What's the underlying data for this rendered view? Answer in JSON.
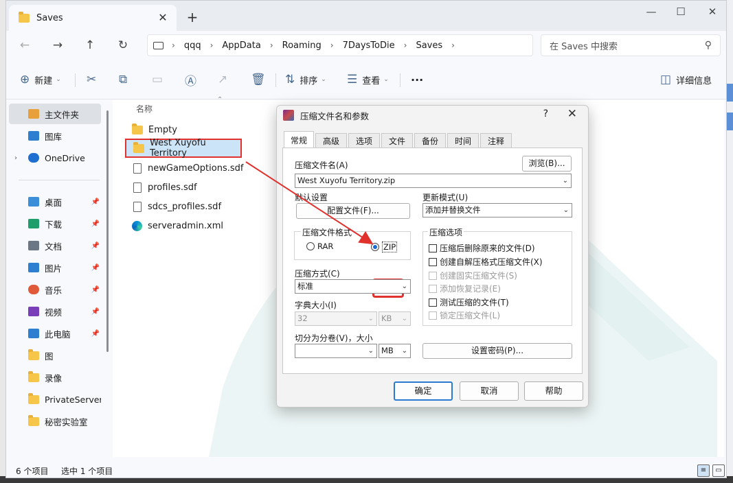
{
  "window": {
    "tab_title": "Saves",
    "tab_close": "✕",
    "new_tab": "+",
    "controls": {
      "minimize": "—",
      "maximize": "☐",
      "close": "✕"
    }
  },
  "nav": {
    "back": "←",
    "forward": "→",
    "up": "↑",
    "refresh": "↻",
    "breadcrumb": [
      "qqq",
      "AppData",
      "Roaming",
      "7DaysToDie",
      "Saves"
    ],
    "search_placeholder": "在 Saves 中搜索"
  },
  "toolbar": {
    "new_label": "新建",
    "sort_label": "排序",
    "view_label": "查看",
    "more": "···",
    "details_label": "详细信息"
  },
  "sidebar": {
    "items": [
      {
        "label": "主文件夹",
        "icon": "home-icon",
        "color": "#e8a13a"
      },
      {
        "label": "图库",
        "icon": "gallery-icon",
        "color": "#2f7fd0"
      },
      {
        "label": "OneDrive",
        "icon": "cloud-icon",
        "color": "#1f6fd0"
      },
      {
        "label": "桌面",
        "icon": "desktop-icon",
        "color": "#3b8ed8"
      },
      {
        "label": "下载",
        "icon": "download-icon",
        "color": "#1e9e6a"
      },
      {
        "label": "文档",
        "icon": "document-icon",
        "color": "#6b7785"
      },
      {
        "label": "图片",
        "icon": "picture-icon",
        "color": "#2f7fd0"
      },
      {
        "label": "音乐",
        "icon": "music-icon",
        "color": "#e05a3a"
      },
      {
        "label": "视频",
        "icon": "video-icon",
        "color": "#7a3fb8"
      },
      {
        "label": "此电脑",
        "icon": "computer-icon",
        "color": "#2f7fd0"
      },
      {
        "label": "图",
        "icon": "folder-icon",
        "color": "#f6c64a"
      },
      {
        "label": "录像",
        "icon": "folder-icon",
        "color": "#f6c64a"
      },
      {
        "label": "PrivateServerT",
        "icon": "folder-icon",
        "color": "#f6c64a"
      },
      {
        "label": "秘密实验室",
        "icon": "folder-icon",
        "color": "#f6c64a"
      }
    ]
  },
  "files": {
    "column_name": "名称",
    "items": [
      {
        "name": "Empty",
        "type": "folder"
      },
      {
        "name": "West Xuyofu Territory",
        "type": "folder",
        "selected": true
      },
      {
        "name": "newGameOptions.sdf",
        "type": "file"
      },
      {
        "name": "profiles.sdf",
        "type": "file"
      },
      {
        "name": "sdcs_profiles.sdf",
        "type": "file"
      },
      {
        "name": "serveradmin.xml",
        "type": "edge"
      }
    ]
  },
  "status": {
    "count": "6 个项目",
    "selected": "选中 1 个项目"
  },
  "dialog": {
    "title": "压缩文件名和参数",
    "help_q": "?",
    "close": "✕",
    "tabs": [
      "常规",
      "高级",
      "选项",
      "文件",
      "备份",
      "时间",
      "注释"
    ],
    "archive_name_label": "压缩文件名(A)",
    "browse": "浏览(B)...",
    "archive_name": "West Xuyofu Territory.zip",
    "default_settings": "默认设置",
    "profiles_button": "配置文件(F)...",
    "update_mode_label": "更新模式(U)",
    "update_mode": "添加并替换文件",
    "format_label": "压缩文件格式",
    "format_rar": "RAR",
    "format_zip": "ZIP",
    "options_label": "压缩选项",
    "options": [
      {
        "label": "压缩后删除原来的文件(D)",
        "disabled": false
      },
      {
        "label": "创建自解压格式压缩文件(X)",
        "disabled": false
      },
      {
        "label": "创建固实压缩文件(S)",
        "disabled": true
      },
      {
        "label": "添加恢复记录(E)",
        "disabled": true
      },
      {
        "label": "测试压缩的文件(T)",
        "disabled": false
      },
      {
        "label": "锁定压缩文件(L)",
        "disabled": true
      }
    ],
    "method_label": "压缩方式(C)",
    "method": "标准",
    "dict_label": "字典大小(I)",
    "dict_value": "32",
    "dict_unit": "KB",
    "split_label": "切分为分卷(V)，大小",
    "split_value": "",
    "split_unit": "MB",
    "password_button": "设置密码(P)...",
    "ok": "确定",
    "cancel": "取消",
    "help": "帮助"
  }
}
